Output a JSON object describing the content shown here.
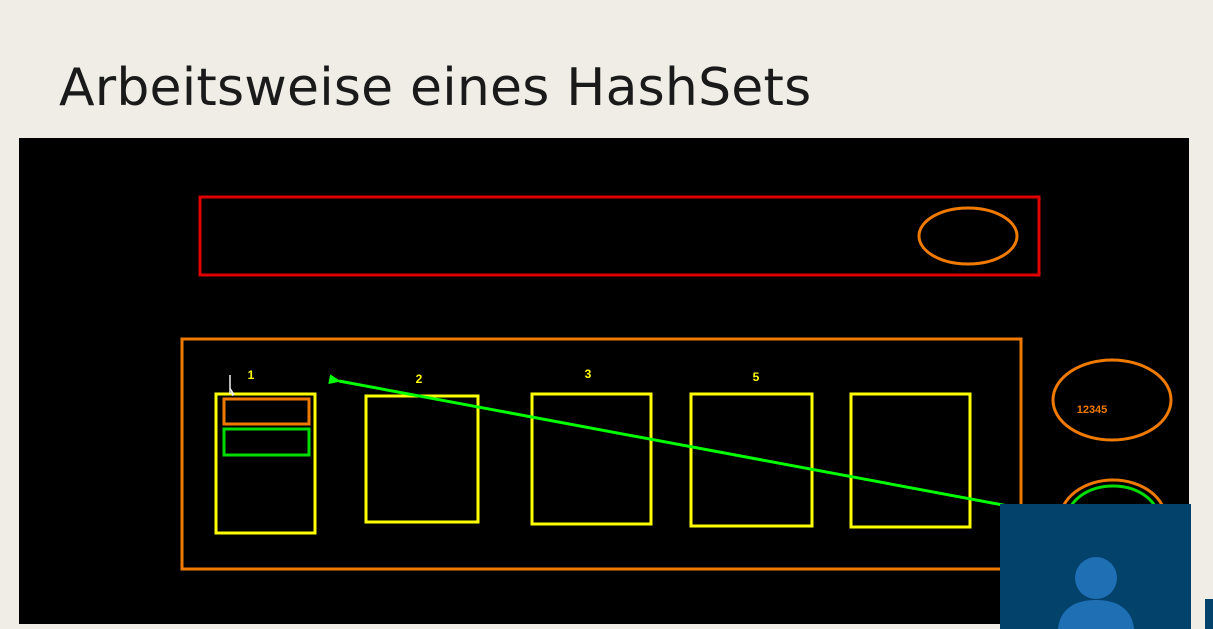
{
  "slide": {
    "title": "Arbeitsweise eines HashSets"
  },
  "drawing": {
    "bucket_labels": [
      "1",
      "2",
      "3",
      "5"
    ],
    "hash_value": "12345",
    "colors": {
      "background": "#000000",
      "input_box": "#e00000",
      "hashset_container": "#f07a00",
      "bucket": "#ffff00",
      "stored_entry_orange": "#f07a00",
      "stored_entry_green": "#00dd00",
      "arrow": "#00ff00",
      "label_text": "#ffff00",
      "hash_text": "#f07a00"
    }
  },
  "webcam": {
    "icon": "user-avatar-icon",
    "background": "#03426b"
  }
}
